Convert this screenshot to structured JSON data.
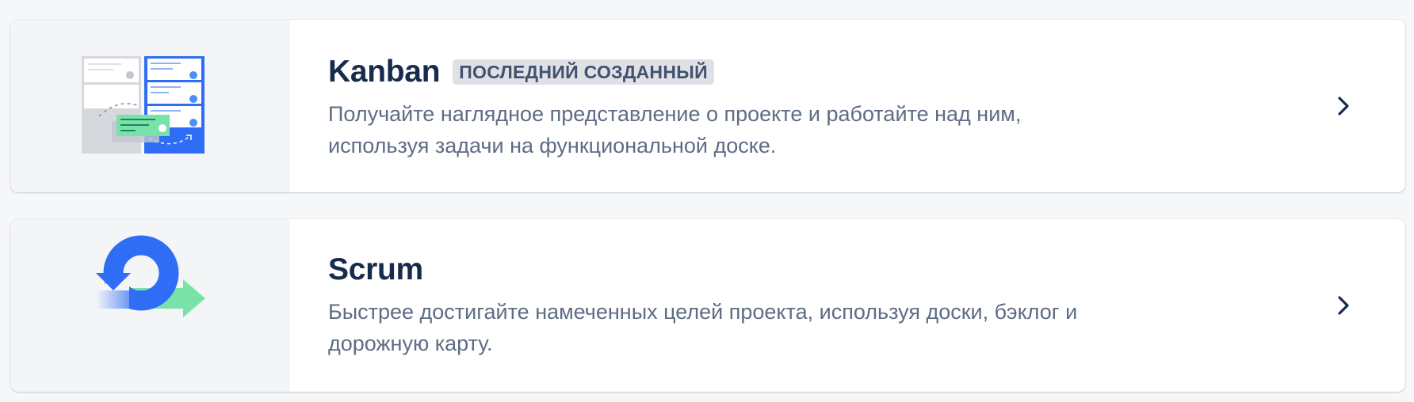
{
  "templates": [
    {
      "id": "kanban",
      "title": "Kanban",
      "badge": "ПОСЛЕДНИЙ СОЗДАННЫЙ",
      "description_line1": "Получайте наглядное представление о проекте и работайте над ним,",
      "description_line2": "используя задачи на функциональной доске."
    },
    {
      "id": "scrum",
      "title": "Scrum",
      "description_line1": "Быстрее достигайте намеченных целей проекта, используя доски, бэклог и",
      "description_line2": "дорожную карту."
    }
  ],
  "colors": {
    "title": "#172b4d",
    "description": "#5e6c84",
    "badge_bg": "#dfe1e6",
    "badge_text": "#42526e",
    "brand_blue": "#2f6df6",
    "accent_green": "#79e2a8"
  },
  "icons": {
    "kanban_illustration": "kanban-board-illustration",
    "scrum_illustration": "scrum-cycle-illustration",
    "chevron": "chevron-right-icon"
  }
}
